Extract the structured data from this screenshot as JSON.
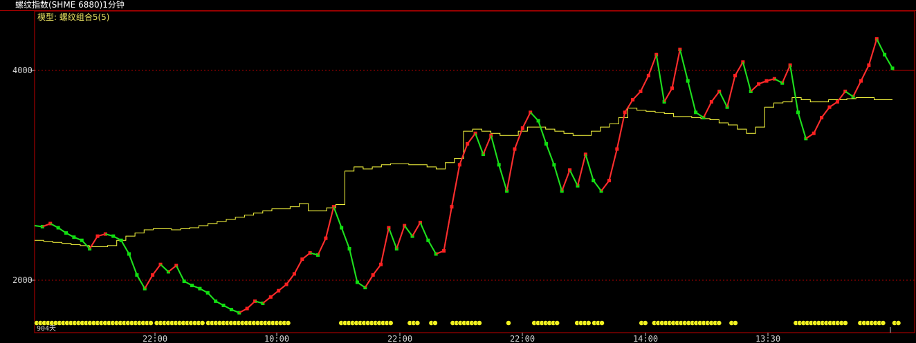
{
  "window": {
    "title": "螺纹指数(SHME 6880)1分钟"
  },
  "model_label": "模型: 螺纹组合5(5)",
  "bar_count_label": "904天",
  "colors": {
    "price_line": "#c8c8c8",
    "uptrend": "#ff2020",
    "downtrend": "#10e010",
    "ma_line": "#ffff40",
    "signal_dots": "#f0f020",
    "grid": "#b00000",
    "frame": "#c00000"
  },
  "chart_data": {
    "type": "line",
    "y_ticks": [
      {
        "value": 4000,
        "label": "4000"
      },
      {
        "value": 2000,
        "label": "2000"
      }
    ],
    "x_ticks": [
      "22:00",
      "10:00",
      "22:00",
      "22:00",
      "14:00",
      "13:30"
    ],
    "grid": "dotted horizontal at y ticks",
    "series": [
      {
        "role": "price",
        "values": [
          2520,
          2510,
          2540,
          2500,
          2450,
          2410,
          2380,
          2300,
          2420,
          2440,
          2420,
          2380,
          2250,
          2050,
          1920,
          2050,
          2150,
          2080,
          2140,
          1990,
          1950,
          1920,
          1880,
          1800,
          1760,
          1720,
          1690,
          1730,
          1800,
          1780,
          1840,
          1900,
          1960,
          2060,
          2200,
          2260,
          2240,
          2400,
          2700,
          2500,
          2300,
          1980,
          1930,
          2050,
          2150,
          2500,
          2300,
          2520,
          2420,
          2550,
          2380,
          2250,
          2280,
          2700,
          3100,
          3300,
          3400,
          3200,
          3380,
          3100,
          2850,
          3250,
          3450,
          3600,
          3520,
          3300,
          3100,
          2850,
          3050,
          2900,
          3200,
          2950,
          2850,
          2950,
          3250,
          3600,
          3720,
          3800,
          3950,
          4150,
          3700,
          3830,
          4200,
          3900,
          3600,
          3550,
          3700,
          3800,
          3650,
          3950,
          4080,
          3800,
          3870,
          3900,
          3920,
          3880,
          4050,
          3600,
          3350,
          3400,
          3550,
          3650,
          3700,
          3800,
          3750,
          3900,
          4050,
          4300,
          4150,
          4020
        ]
      },
      {
        "role": "average",
        "values": [
          2380,
          2370,
          2360,
          2350,
          2340,
          2330,
          2320,
          2320,
          2330,
          2380,
          2420,
          2450,
          2480,
          2490,
          2490,
          2480,
          2490,
          2500,
          2520,
          2540,
          2560,
          2580,
          2600,
          2620,
          2640,
          2660,
          2680,
          2680,
          2700,
          2730,
          2660,
          2660,
          2690,
          2720,
          3040,
          3080,
          3060,
          3080,
          3100,
          3110,
          3110,
          3100,
          3100,
          3080,
          3060,
          3120,
          3160,
          3420,
          3440,
          3420,
          3400,
          3380,
          3380,
          3420,
          3460,
          3460,
          3440,
          3420,
          3400,
          3380,
          3380,
          3420,
          3460,
          3490,
          3550,
          3640,
          3620,
          3610,
          3600,
          3590,
          3560,
          3560,
          3550,
          3540,
          3530,
          3500,
          3480,
          3440,
          3400,
          3460,
          3650,
          3690,
          3700,
          3740,
          3720,
          3700,
          3700,
          3720,
          3720,
          3730,
          3740,
          3740,
          3720,
          3720,
          3720
        ]
      }
    ],
    "signal_dot_runs": [
      [
        0.0,
        0.14
      ],
      [
        0.14,
        0.2
      ],
      [
        0.2,
        0.3
      ],
      [
        0.355,
        0.42
      ],
      [
        0.435,
        0.45
      ],
      [
        0.46,
        0.47
      ],
      [
        0.485,
        0.52
      ],
      [
        0.55,
        0.555
      ],
      [
        0.58,
        0.61
      ],
      [
        0.63,
        0.65
      ],
      [
        0.65,
        0.665
      ],
      [
        0.705,
        0.715
      ],
      [
        0.72,
        0.8
      ],
      [
        0.81,
        0.82
      ],
      [
        0.885,
        0.95
      ],
      [
        0.96,
        0.99
      ],
      [
        1.0,
        1.01
      ]
    ]
  }
}
